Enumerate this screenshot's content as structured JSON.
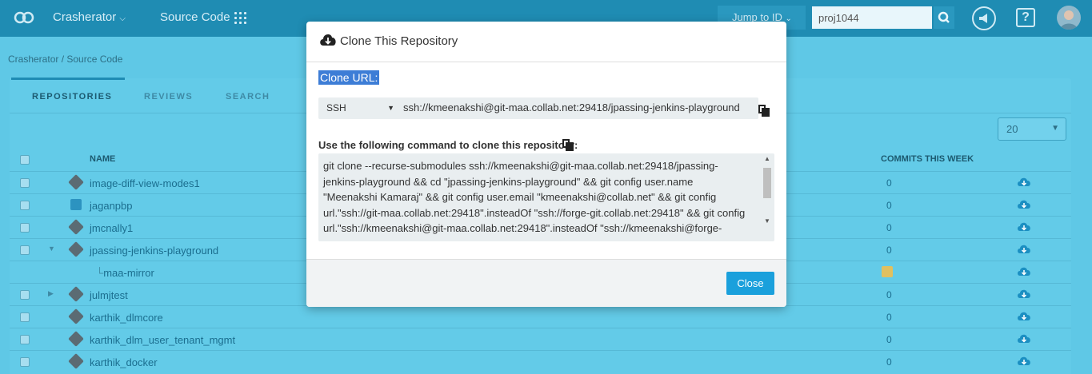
{
  "topbar": {
    "project_menu": "Crasherator",
    "source_code": "Source Code",
    "jump_to": "Jump to ID",
    "search_value": "proj1044",
    "help": "?"
  },
  "breadcrumb": "Crasherator  /  Source Code",
  "tabs": [
    "REPOSITORIES",
    "REVIEWS",
    "SEARCH"
  ],
  "per_page": "20",
  "table": {
    "col_name": "NAME",
    "col_commits": "COMMITS THIS WEEK",
    "rows": [
      {
        "name": "image-diff-view-modes1",
        "commits": "0"
      },
      {
        "name": "jaganpbp",
        "commits": "0"
      },
      {
        "name": "jmcnally1",
        "commits": "0"
      },
      {
        "name": "jpassing-jenkins-playground",
        "commits": "0"
      },
      {
        "name": "maa-mirror",
        "commits": ""
      },
      {
        "name": "julmjtest",
        "commits": "0"
      },
      {
        "name": "karthik_dlmcore",
        "commits": "0"
      },
      {
        "name": "karthik_dlm_user_tenant_mgmt",
        "commits": "0"
      },
      {
        "name": "karthik_docker",
        "commits": "0"
      }
    ]
  },
  "modal": {
    "title": "Clone This Repository",
    "clone_url_label": "Clone URL:",
    "protocol": "SSH",
    "url": "ssh://kmeenakshi@git-maa.collab.net:29418/jpassing-jenkins-playground",
    "cmd_label": "Use the following command to clone this repository:",
    "cmd_lines": [
      "git clone --recurse-submodules ssh://kmeenakshi@git-maa.collab.net:29418/jpassing-",
      "jenkins-playground && cd \"jpassing-jenkins-playground\" && git config user.name",
      "\"Meenakshi Kamaraj\" && git config user.email \"kmeenakshi@collab.net\" && git config",
      "url.\"ssh://git-maa.collab.net:29418\".insteadOf \"ssh://forge-git.collab.net:29418\" && git config",
      "url.\"ssh://kmeenakshi@git-maa.collab.net:29418\".insteadOf \"ssh://kmeenakshi@forge-"
    ],
    "close_label": "Close"
  },
  "colors": {
    "topbar": "#1f8cb3",
    "page": "#5fc8e6",
    "accent": "#1aa0dc",
    "selection": "#3d7dd6"
  }
}
